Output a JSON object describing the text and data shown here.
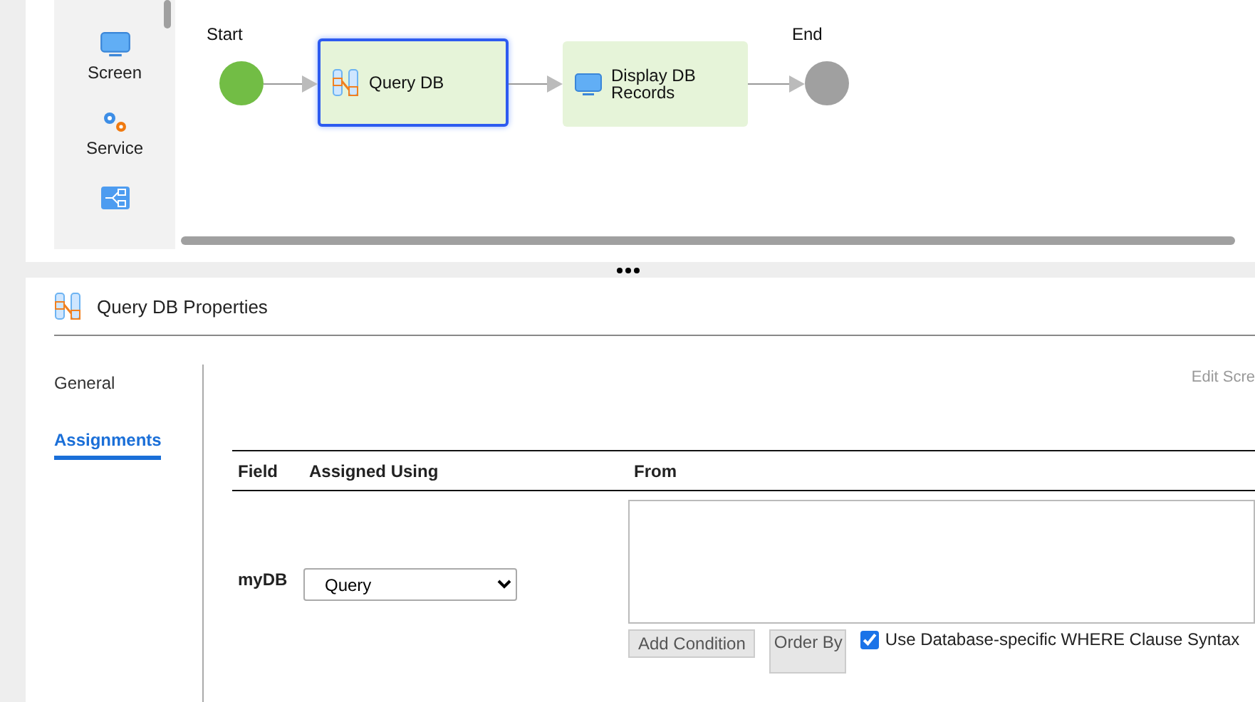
{
  "palette": {
    "items": [
      {
        "kind": "screen",
        "label": "Screen"
      },
      {
        "kind": "service",
        "label": "Service"
      },
      {
        "kind": "process"
      }
    ]
  },
  "diagram": {
    "nodes": [
      {
        "kind": "start",
        "label": "Start"
      },
      {
        "kind": "query",
        "label": "Query DB",
        "selected": true
      },
      {
        "kind": "screen",
        "label": "Display DB Records",
        "selected": false
      },
      {
        "kind": "end",
        "label": "End"
      }
    ]
  },
  "properties": {
    "title": "Query DB Properties",
    "tabs": [
      {
        "label": "General",
        "selected": false
      },
      {
        "label": "Assignments",
        "selected": true
      }
    ],
    "edit_link": "Edit Scre",
    "table": {
      "columns": [
        "Field",
        "Assigned Using",
        "From"
      ],
      "rows": [
        {
          "field": "myDB",
          "assigned_using": "Query",
          "from": "",
          "buttons": [
            "Add Condition",
            "Order By"
          ],
          "checkbox": {
            "label": "Use Database-specific WHERE Clause Syntax",
            "checked": true
          }
        }
      ]
    }
  }
}
